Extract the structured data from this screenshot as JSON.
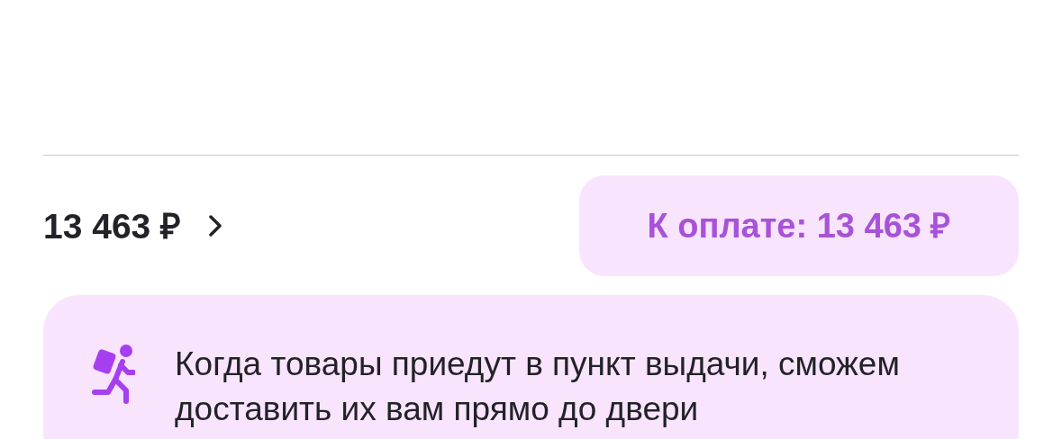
{
  "total": {
    "amount": "13 463 ₽"
  },
  "pay_button": {
    "label": "К оплате: 13 463 ₽"
  },
  "delivery_note": {
    "text": "Когда товары приедут в пункт выдачи, сможем доставить их вам прямо до двери"
  }
}
